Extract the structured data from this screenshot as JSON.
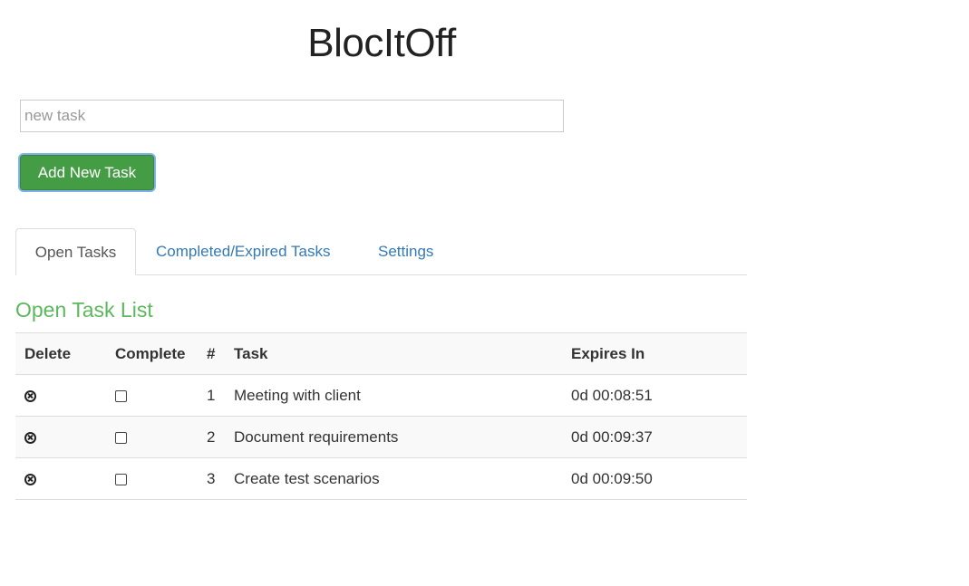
{
  "app": {
    "title": "BlocItOff"
  },
  "new_task": {
    "placeholder": "new task",
    "value": ""
  },
  "add_button": {
    "label": "Add New Task",
    "color": "#449d44"
  },
  "tabs": [
    {
      "label": "Open Tasks",
      "active": true
    },
    {
      "label": "Completed/Expired Tasks",
      "active": false
    },
    {
      "label": "Settings",
      "active": false
    }
  ],
  "section": {
    "heading": "Open Task List",
    "heading_color": "#5cb85c"
  },
  "table": {
    "headers": [
      "Delete",
      "Complete",
      "#",
      "Task",
      "Expires In"
    ],
    "rows": [
      {
        "num": "1",
        "task": "Meeting with client",
        "expires": "0d 00:08:51",
        "complete": false,
        "delete_icon": "circle-x-icon"
      },
      {
        "num": "2",
        "task": "Document requirements",
        "expires": "0d 00:09:37",
        "complete": false,
        "delete_icon": "circle-x-icon"
      },
      {
        "num": "3",
        "task": "Create test scenarios",
        "expires": "0d 00:09:50",
        "complete": false,
        "delete_icon": "circle-x-icon"
      }
    ]
  },
  "colors": {
    "link": "#337ab7",
    "text": "#333333",
    "stripe": "#f9f9f9"
  }
}
